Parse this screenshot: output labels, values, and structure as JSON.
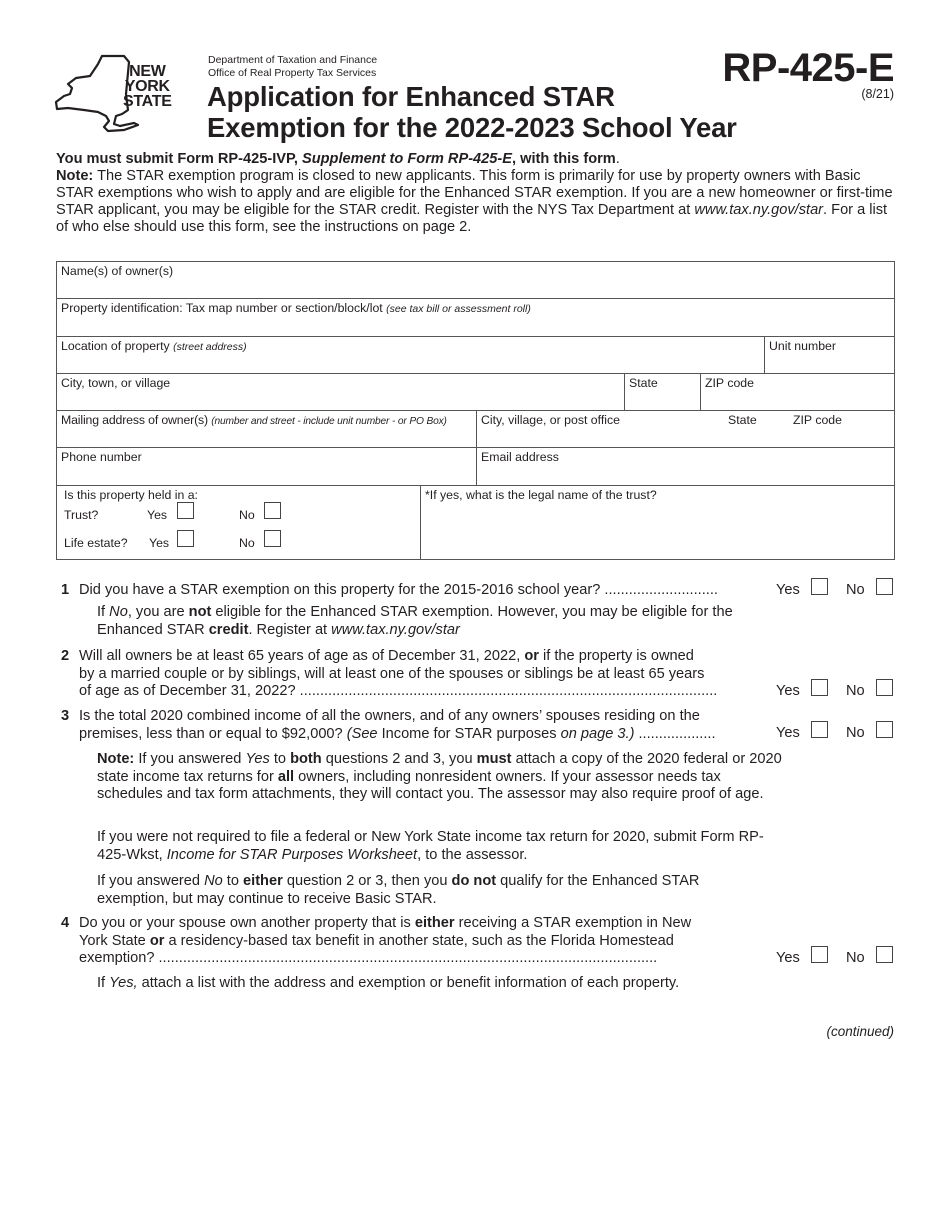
{
  "header": {
    "logo_text": [
      "NEW",
      "YORK",
      "STATE"
    ],
    "agency_line1": "Department of Taxation and Finance",
    "agency_line2": "Office of Real Property Tax Services",
    "title_line1": "Application for Enhanced STAR",
    "title_line2": "Exemption for the 2022-2023 School Year",
    "form_number": "RP-425-E",
    "revision": "(8/21)"
  },
  "intro": {
    "must_prefix": "You must submit Form RP-425-IVP, ",
    "must_italic": "Supplement to Form RP-425-E",
    "must_suffix": ", with this form",
    "must_period": ".",
    "note_label": "Note:",
    "note_text": " The STAR exemption program is closed to new applicants. This form is primarily for use by property owners with Basic STAR exemptions who wish to apply and are eligible for the Enhanced STAR exemption. If you are a new homeowner or first-time STAR applicant, you may be eligible for the STAR credit. Register with the NYS Tax Department at ",
    "note_url": "www.tax.ny.gov/star",
    "note_end": ". For a list of who else should use this form, see the instructions on page 2."
  },
  "form_fields": {
    "owner_names": "Name(s) of owner(s)",
    "property_id": "Property identification: Tax map number or section/block/lot ",
    "property_id_hint": "(see tax bill or assessment roll)",
    "location": "Location of property ",
    "location_hint": "(street address)",
    "unit_number": "Unit number",
    "city": "City, town, or village",
    "state": "State",
    "zip": "ZIP code",
    "mailing": "Mailing address of owner(s) ",
    "mailing_hint": "(number and street - include unit number - or PO Box)",
    "mail_city": "City, village, or post office",
    "mail_state": "State",
    "mail_zip": "ZIP code",
    "phone": "Phone number",
    "email": "Email address",
    "held_in": "Is this property held in a:",
    "trust": "Trust?",
    "life_estate": "Life estate?",
    "yes": "Yes",
    "no": "No",
    "trust_name": "*If yes, what is the legal name of the trust?"
  },
  "questions": [
    {
      "number": "1",
      "text": "Did you have a STAR exemption on this property for the 2015-2016 school year? ............................",
      "yes": "Yes",
      "no": "No"
    },
    {
      "number": "2",
      "line1_a": "Will all owners be at least 65 years of age as of December 31, 2022, ",
      "line1_b": "or",
      "line1_c": " if the property is owned",
      "line2": "by a married couple or by siblings, will at least one of the spouses or siblings be at least 65 years",
      "line3": "of age as of December 31, 2022? .......................................................................................................",
      "yes": "Yes",
      "no": "No"
    },
    {
      "number": "3",
      "line1": "Is the total 2020 combined income of all the owners, and of any owners’ spouses residing on the",
      "line2_a": "premises, less than or equal to $92,000? ",
      "line2_b": "(See",
      "line2_c": " Income for STAR purposes ",
      "line2_d": "on page 3.)",
      "line2_e": " ...................",
      "yes": "Yes",
      "no": "No"
    },
    {
      "number": "4",
      "line1_a": "Do you or your spouse own another property that is ",
      "line1_b": "either",
      "line1_c": " receiving a STAR exemption in New",
      "line2_a": "York State ",
      "line2_b": "or",
      "line2_c": " a residency-based tax benefit in another state, such as the Florida Homestead",
      "line3": "exemption? ...........................................................................................................................",
      "yes": "Yes",
      "no": "No"
    }
  ],
  "notes": {
    "q1_a": "If ",
    "q1_no": "No",
    "q1_b": ", you are ",
    "q1_not": "not",
    "q1_c": " eligible for the Enhanced STAR exemption. However, you may be eligible for the Enhanced STAR ",
    "q1_credit": "credit",
    "q1_d": ". Register at ",
    "q1_url": "www.tax.ny.gov/star",
    "q3_note_label": "Note:",
    "q3_a": " If you answered ",
    "q3_yes": "Yes",
    "q3_b": " to ",
    "q3_both": "both",
    "q3_c": " questions 2 and 3, you ",
    "q3_must": "must",
    "q3_d": " attach a copy of the 2020 federal or 2020 state income tax returns for ",
    "q3_all": "all",
    "q3_e": " owners, including nonresident owners. If your assessor needs tax schedules and tax form attachments, they will contact you. The assessor may also require proof of age.",
    "q3_file_a": "If you were not required to file a federal or New York State income tax return for 2020, submit Form RP-425-Wkst, ",
    "q3_file_italic": "Income for STAR Purposes Worksheet",
    "q3_file_b": ", to the assessor.",
    "q3_either_a": "If you answered ",
    "q3_either_no": "No",
    "q3_either_b": " to ",
    "q3_either_bold": "either",
    "q3_either_c": " question 2 or 3, then you ",
    "q3_either_donot": "do not",
    "q3_either_d": " qualify for the Enhanced STAR exemption, but may continue to receive Basic STAR.",
    "q4_a": "If ",
    "q4_yes": "Yes,",
    "q4_b": " attach a list with the address and exemption or benefit information of each property."
  },
  "footer": {
    "continued": "(continued)"
  }
}
